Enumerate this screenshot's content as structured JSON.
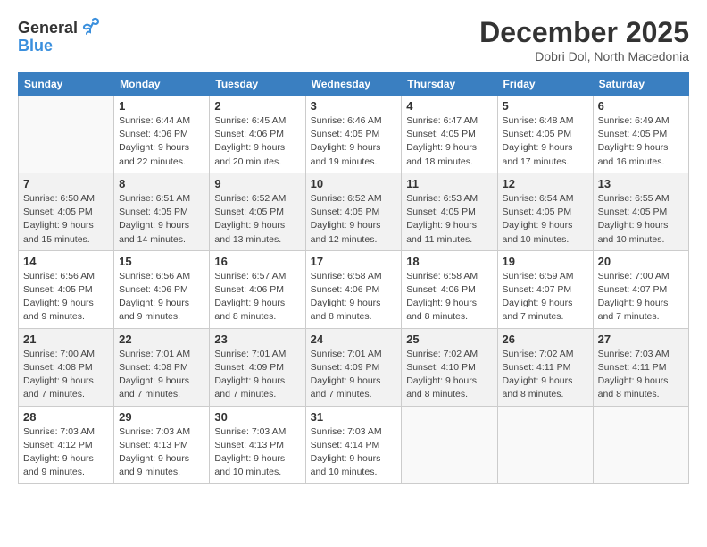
{
  "logo": {
    "general": "General",
    "blue": "Blue"
  },
  "title": "December 2025",
  "location": "Dobri Dol, North Macedonia",
  "days_header": [
    "Sunday",
    "Monday",
    "Tuesday",
    "Wednesday",
    "Thursday",
    "Friday",
    "Saturday"
  ],
  "weeks": [
    [
      {
        "day": "",
        "sunrise": "",
        "sunset": "",
        "daylight": ""
      },
      {
        "day": "1",
        "sunrise": "Sunrise: 6:44 AM",
        "sunset": "Sunset: 4:06 PM",
        "daylight": "Daylight: 9 hours and 22 minutes."
      },
      {
        "day": "2",
        "sunrise": "Sunrise: 6:45 AM",
        "sunset": "Sunset: 4:06 PM",
        "daylight": "Daylight: 9 hours and 20 minutes."
      },
      {
        "day": "3",
        "sunrise": "Sunrise: 6:46 AM",
        "sunset": "Sunset: 4:05 PM",
        "daylight": "Daylight: 9 hours and 19 minutes."
      },
      {
        "day": "4",
        "sunrise": "Sunrise: 6:47 AM",
        "sunset": "Sunset: 4:05 PM",
        "daylight": "Daylight: 9 hours and 18 minutes."
      },
      {
        "day": "5",
        "sunrise": "Sunrise: 6:48 AM",
        "sunset": "Sunset: 4:05 PM",
        "daylight": "Daylight: 9 hours and 17 minutes."
      },
      {
        "day": "6",
        "sunrise": "Sunrise: 6:49 AM",
        "sunset": "Sunset: 4:05 PM",
        "daylight": "Daylight: 9 hours and 16 minutes."
      }
    ],
    [
      {
        "day": "7",
        "sunrise": "Sunrise: 6:50 AM",
        "sunset": "Sunset: 4:05 PM",
        "daylight": "Daylight: 9 hours and 15 minutes."
      },
      {
        "day": "8",
        "sunrise": "Sunrise: 6:51 AM",
        "sunset": "Sunset: 4:05 PM",
        "daylight": "Daylight: 9 hours and 14 minutes."
      },
      {
        "day": "9",
        "sunrise": "Sunrise: 6:52 AM",
        "sunset": "Sunset: 4:05 PM",
        "daylight": "Daylight: 9 hours and 13 minutes."
      },
      {
        "day": "10",
        "sunrise": "Sunrise: 6:52 AM",
        "sunset": "Sunset: 4:05 PM",
        "daylight": "Daylight: 9 hours and 12 minutes."
      },
      {
        "day": "11",
        "sunrise": "Sunrise: 6:53 AM",
        "sunset": "Sunset: 4:05 PM",
        "daylight": "Daylight: 9 hours and 11 minutes."
      },
      {
        "day": "12",
        "sunrise": "Sunrise: 6:54 AM",
        "sunset": "Sunset: 4:05 PM",
        "daylight": "Daylight: 9 hours and 10 minutes."
      },
      {
        "day": "13",
        "sunrise": "Sunrise: 6:55 AM",
        "sunset": "Sunset: 4:05 PM",
        "daylight": "Daylight: 9 hours and 10 minutes."
      }
    ],
    [
      {
        "day": "14",
        "sunrise": "Sunrise: 6:56 AM",
        "sunset": "Sunset: 4:05 PM",
        "daylight": "Daylight: 9 hours and 9 minutes."
      },
      {
        "day": "15",
        "sunrise": "Sunrise: 6:56 AM",
        "sunset": "Sunset: 4:06 PM",
        "daylight": "Daylight: 9 hours and 9 minutes."
      },
      {
        "day": "16",
        "sunrise": "Sunrise: 6:57 AM",
        "sunset": "Sunset: 4:06 PM",
        "daylight": "Daylight: 9 hours and 8 minutes."
      },
      {
        "day": "17",
        "sunrise": "Sunrise: 6:58 AM",
        "sunset": "Sunset: 4:06 PM",
        "daylight": "Daylight: 9 hours and 8 minutes."
      },
      {
        "day": "18",
        "sunrise": "Sunrise: 6:58 AM",
        "sunset": "Sunset: 4:06 PM",
        "daylight": "Daylight: 9 hours and 8 minutes."
      },
      {
        "day": "19",
        "sunrise": "Sunrise: 6:59 AM",
        "sunset": "Sunset: 4:07 PM",
        "daylight": "Daylight: 9 hours and 7 minutes."
      },
      {
        "day": "20",
        "sunrise": "Sunrise: 7:00 AM",
        "sunset": "Sunset: 4:07 PM",
        "daylight": "Daylight: 9 hours and 7 minutes."
      }
    ],
    [
      {
        "day": "21",
        "sunrise": "Sunrise: 7:00 AM",
        "sunset": "Sunset: 4:08 PM",
        "daylight": "Daylight: 9 hours and 7 minutes."
      },
      {
        "day": "22",
        "sunrise": "Sunrise: 7:01 AM",
        "sunset": "Sunset: 4:08 PM",
        "daylight": "Daylight: 9 hours and 7 minutes."
      },
      {
        "day": "23",
        "sunrise": "Sunrise: 7:01 AM",
        "sunset": "Sunset: 4:09 PM",
        "daylight": "Daylight: 9 hours and 7 minutes."
      },
      {
        "day": "24",
        "sunrise": "Sunrise: 7:01 AM",
        "sunset": "Sunset: 4:09 PM",
        "daylight": "Daylight: 9 hours and 7 minutes."
      },
      {
        "day": "25",
        "sunrise": "Sunrise: 7:02 AM",
        "sunset": "Sunset: 4:10 PM",
        "daylight": "Daylight: 9 hours and 8 minutes."
      },
      {
        "day": "26",
        "sunrise": "Sunrise: 7:02 AM",
        "sunset": "Sunset: 4:11 PM",
        "daylight": "Daylight: 9 hours and 8 minutes."
      },
      {
        "day": "27",
        "sunrise": "Sunrise: 7:03 AM",
        "sunset": "Sunset: 4:11 PM",
        "daylight": "Daylight: 9 hours and 8 minutes."
      }
    ],
    [
      {
        "day": "28",
        "sunrise": "Sunrise: 7:03 AM",
        "sunset": "Sunset: 4:12 PM",
        "daylight": "Daylight: 9 hours and 9 minutes."
      },
      {
        "day": "29",
        "sunrise": "Sunrise: 7:03 AM",
        "sunset": "Sunset: 4:13 PM",
        "daylight": "Daylight: 9 hours and 9 minutes."
      },
      {
        "day": "30",
        "sunrise": "Sunrise: 7:03 AM",
        "sunset": "Sunset: 4:13 PM",
        "daylight": "Daylight: 9 hours and 10 minutes."
      },
      {
        "day": "31",
        "sunrise": "Sunrise: 7:03 AM",
        "sunset": "Sunset: 4:14 PM",
        "daylight": "Daylight: 9 hours and 10 minutes."
      },
      {
        "day": "",
        "sunrise": "",
        "sunset": "",
        "daylight": ""
      },
      {
        "day": "",
        "sunrise": "",
        "sunset": "",
        "daylight": ""
      },
      {
        "day": "",
        "sunrise": "",
        "sunset": "",
        "daylight": ""
      }
    ]
  ]
}
